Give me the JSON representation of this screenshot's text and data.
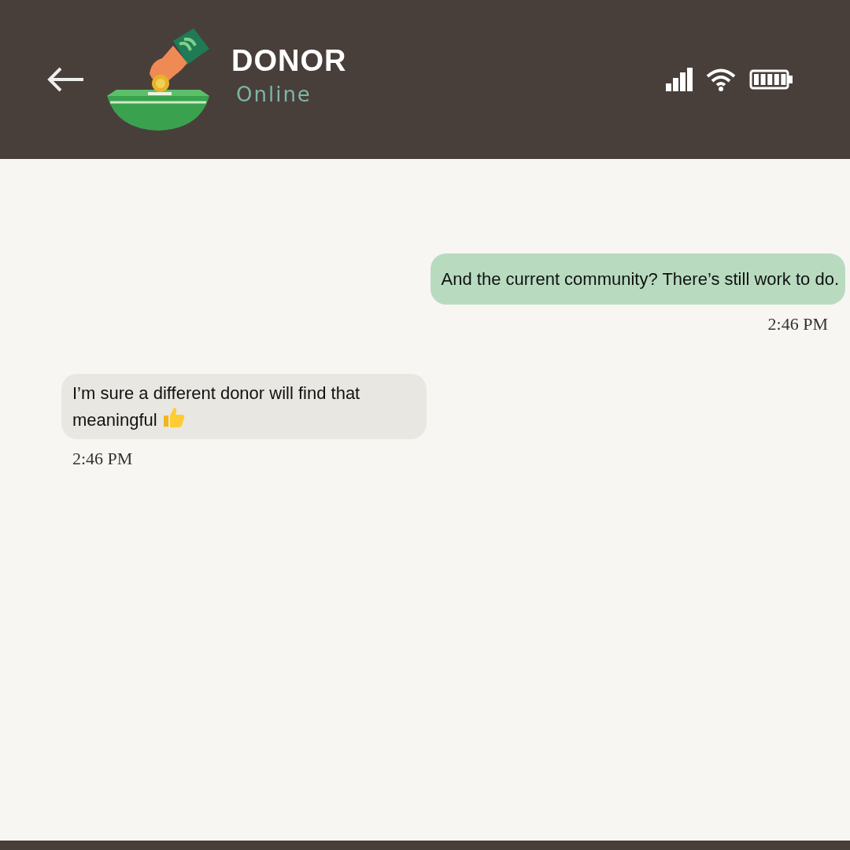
{
  "header": {
    "title": "DONOR",
    "status": "Online"
  },
  "messages": [
    {
      "kind": "sent",
      "text": "And the current community? There’s still work to do.",
      "time": "2:46 PM",
      "reaction": false
    },
    {
      "kind": "received",
      "text": "I’m sure a different donor will find that meaningful",
      "time": "2:46 PM",
      "reaction": true
    }
  ]
}
